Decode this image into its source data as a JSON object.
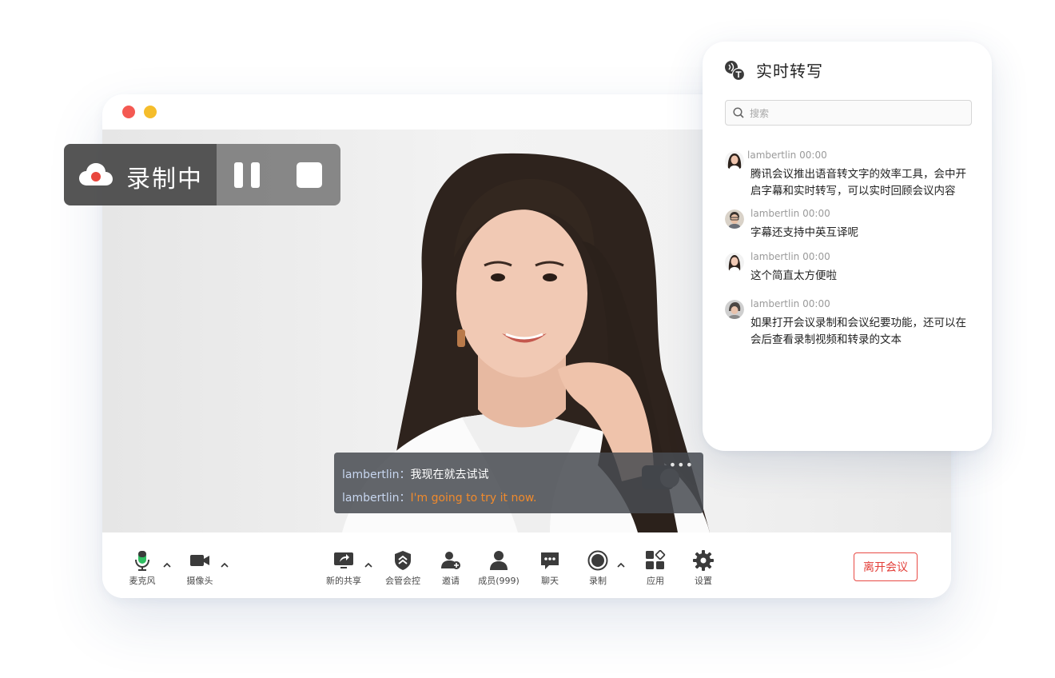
{
  "recording": {
    "status_label": "录制中",
    "cloud_icon": "cloud-record-icon",
    "pause_icon": "pause-icon",
    "stop_icon": "stop-icon"
  },
  "caption": {
    "lines": [
      {
        "speaker": "lambertlin：",
        "text": "我现在就去试试"
      },
      {
        "speaker": "lambertlin：",
        "text": "I'm going to try it now."
      }
    ],
    "more_label": "•••"
  },
  "toolbar": {
    "mic": {
      "label": "麦克风",
      "icon": "microphone-icon"
    },
    "camera": {
      "label": "摄像头",
      "icon": "camera-icon"
    },
    "share": {
      "label": "新的共享",
      "icon": "share-screen-icon"
    },
    "host_control": {
      "label": "会管会控",
      "icon": "shield-icon"
    },
    "invite": {
      "label": "邀请",
      "icon": "invite-user-icon"
    },
    "members": {
      "label": "成员(999)",
      "icon": "members-icon"
    },
    "chat": {
      "label": "聊天",
      "icon": "chat-icon"
    },
    "record": {
      "label": "录制",
      "icon": "record-icon"
    },
    "apps": {
      "label": "应用",
      "icon": "apps-icon"
    },
    "settings": {
      "label": "设置",
      "icon": "gear-icon"
    },
    "leave_label": "离开会议"
  },
  "transcript": {
    "title": "实时转写",
    "search_placeholder": "搜索",
    "messages": [
      {
        "name": "lambertlin",
        "time": "00:00",
        "text": "腾讯会议推出语音转文字的效率工具，会中开启字幕和实时转写，可以实时回顾会议内容"
      },
      {
        "name": "lambertlin",
        "time": "00:00",
        "text": "字幕还支持中英互译呢"
      },
      {
        "name": "lambertlin",
        "time": "00:00",
        "text": "这个简直太方便啦"
      },
      {
        "name": "lambertlin",
        "time": "00:00",
        "text": "如果打开会议录制和会议纪要功能，还可以在会后查看录制视频和转录的文本"
      }
    ]
  },
  "colors": {
    "mic_active": "#2fbf62",
    "leave_red": "#e33e38",
    "caption_translation": "#f08a2c",
    "rec_dot": "#e9463d"
  }
}
